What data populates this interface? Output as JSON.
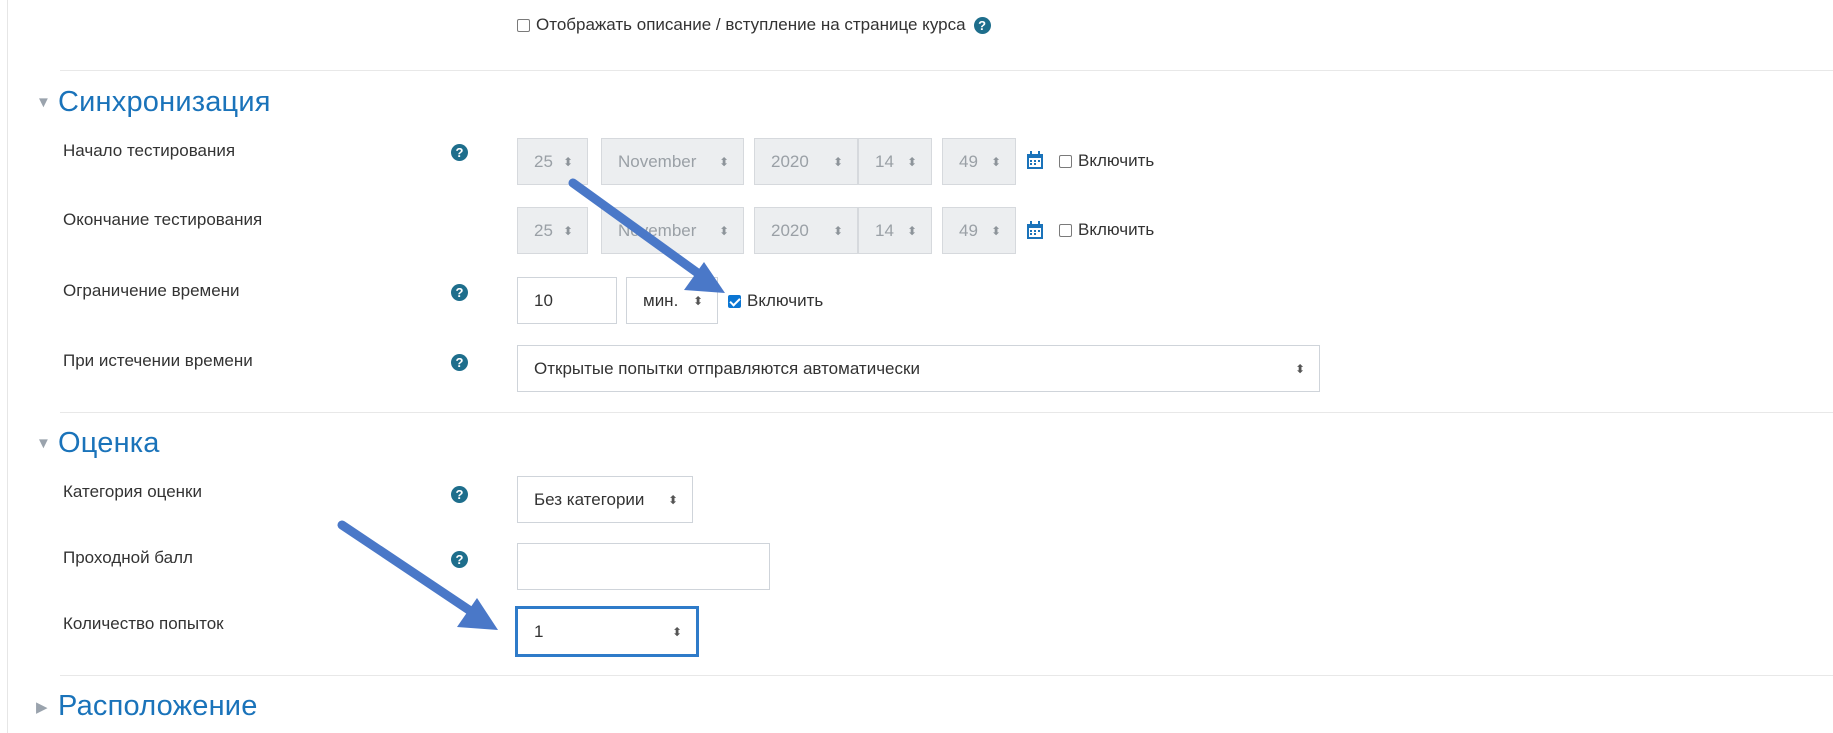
{
  "top_option": {
    "label": "Отображать описание / вступление на странице курса"
  },
  "sections": {
    "sync": {
      "title": "Синхронизация"
    },
    "grade": {
      "title": "Оценка"
    },
    "layout": {
      "title": "Расположение"
    }
  },
  "fields": {
    "open": {
      "label": "Начало тестирования",
      "day": "25",
      "month": "November",
      "year": "2020",
      "hour": "14",
      "minute": "49",
      "enable_label": "Включить",
      "enabled": false
    },
    "close": {
      "label": "Окончание тестирования",
      "day": "25",
      "month": "November",
      "year": "2020",
      "hour": "14",
      "minute": "49",
      "enable_label": "Включить",
      "enabled": false
    },
    "timelimit": {
      "label": "Ограничение времени",
      "value": "10",
      "unit": "мин.",
      "enable_label": "Включить",
      "enabled": true
    },
    "overdue": {
      "label": "При истечении времени",
      "value": "Открытые попытки отправляются автоматически"
    },
    "gradecat": {
      "label": "Категория оценки",
      "value": "Без категории"
    },
    "gradepass": {
      "label": "Проходной балл",
      "value": ""
    },
    "attempts": {
      "label": "Количество попыток",
      "value": "1"
    }
  },
  "colors": {
    "accent": "#1a73ba",
    "help": "#1e6e8c",
    "annotation_arrow": "#4a78c8"
  }
}
